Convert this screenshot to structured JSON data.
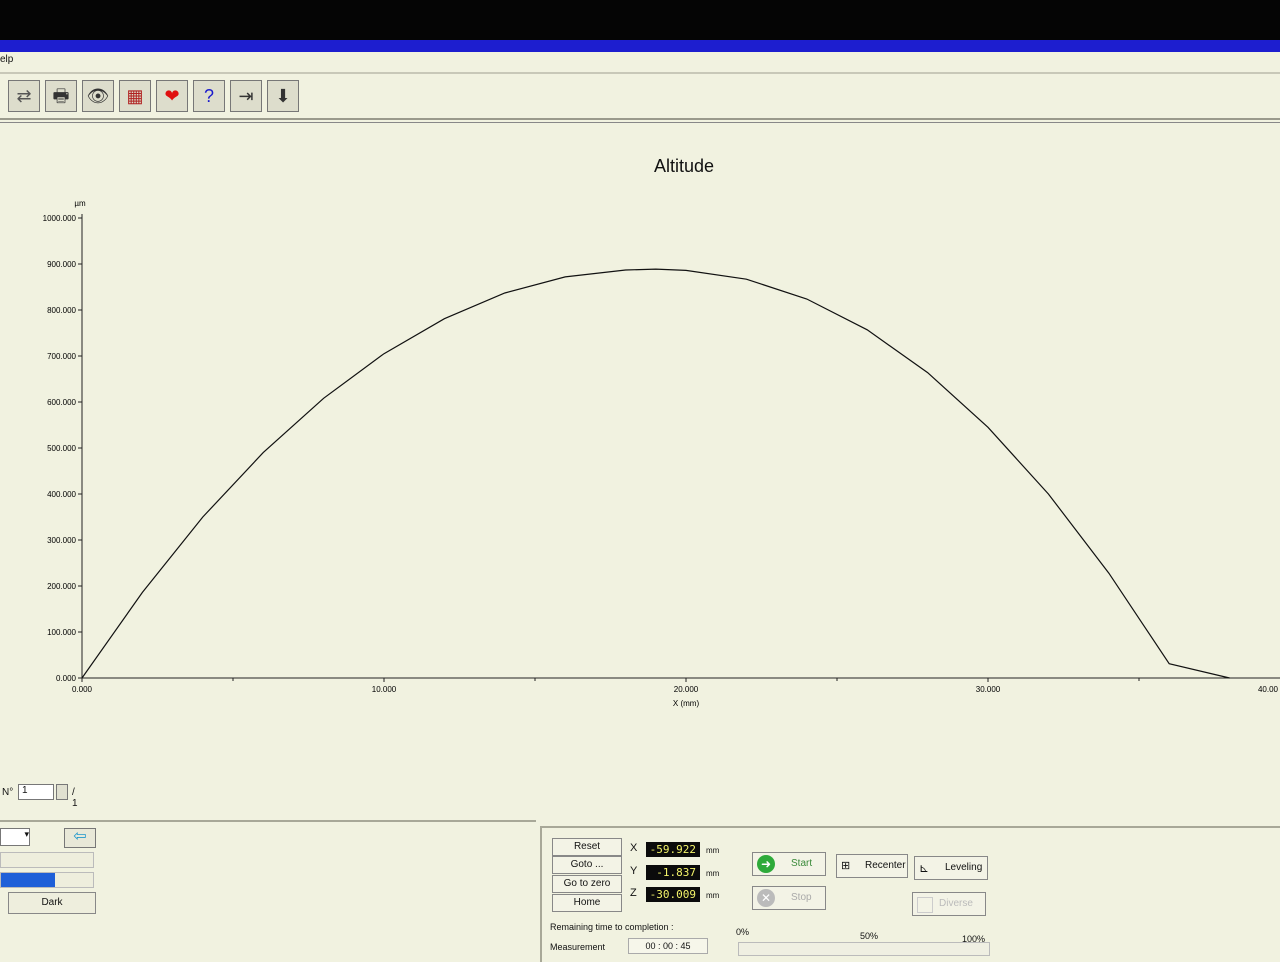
{
  "menu": {
    "partial_text": "elp"
  },
  "toolbar": {
    "buttons": [
      {
        "name": "export-icon",
        "glyph": "⇄"
      },
      {
        "name": "print-icon",
        "glyph": "🖶"
      },
      {
        "name": "view-icon",
        "glyph": "👁"
      },
      {
        "name": "measure-icon",
        "glyph": "▦"
      },
      {
        "name": "heart-icon",
        "glyph": "❤"
      },
      {
        "name": "help-icon",
        "glyph": "?"
      },
      {
        "name": "exit-icon",
        "glyph": "⇥"
      },
      {
        "name": "install-icon",
        "glyph": "⬇"
      }
    ]
  },
  "chart_data": {
    "type": "line",
    "title": "Altitude",
    "xlabel": "X (mm)",
    "ylabel": "µm",
    "xlim": [
      0,
      40
    ],
    "ylim": [
      0,
      1000
    ],
    "x_ticks": [
      "0.000",
      "10.000",
      "20.000",
      "30.000",
      "40.00"
    ],
    "y_ticks": [
      "0.000",
      "100.000",
      "200.000",
      "300.000",
      "400.000",
      "500.000",
      "600.000",
      "700.000",
      "800.000",
      "900.000",
      "1000.000"
    ],
    "grid": false,
    "series": [
      {
        "color": "#111111",
        "x": [
          0,
          2,
          4,
          6,
          8,
          10,
          12,
          14,
          16,
          18,
          19,
          20,
          22,
          24,
          26,
          28,
          30,
          32,
          34,
          36,
          38
        ],
        "y": [
          0,
          186,
          350,
          490,
          608,
          705,
          781,
          837,
          872,
          887,
          889,
          886,
          867,
          824,
          757,
          664,
          545,
          400,
          228,
          31,
          0
        ]
      }
    ]
  },
  "pager": {
    "label": "N°",
    "value": "1",
    "total": "/ 1"
  },
  "left_panel": {
    "dark_label": "Dark"
  },
  "controls": {
    "reset": "Reset",
    "goto": "Goto ...",
    "goto_zero": "Go to zero",
    "home": "Home",
    "x_label": "X",
    "y_label": "Y",
    "z_label": "Z",
    "x_value": "-59.922",
    "y_value": "-1.837",
    "z_value": "-30.009",
    "unit": "mm",
    "start": "Start",
    "stop": "Stop",
    "recenter": "Recenter",
    "leveling": "Leveling",
    "disabled_action": "Diverse",
    "remaining_label": "Remaining time to completion :",
    "measurement_label": "Measurement",
    "time_value": "00 : 00 : 45",
    "p0": "0%",
    "p50": "50%",
    "p100": "100%",
    "progress": 0
  },
  "colors": {
    "accent": "#1d1ecf",
    "readout_bg": "#0b0b0b",
    "readout_fg": "#f4f46a"
  }
}
